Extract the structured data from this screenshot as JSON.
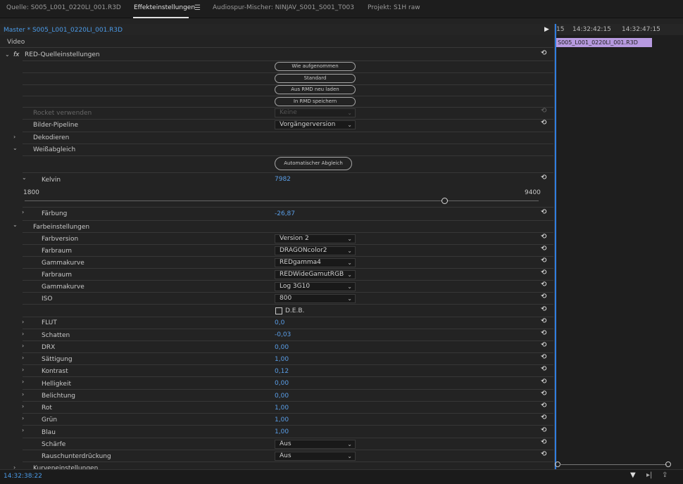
{
  "tabs": [
    {
      "label": "Quelle: S005_L001_0220LI_001.R3D"
    },
    {
      "label": "Effekteinstellungen"
    },
    {
      "label": "Audiospur-Mischer: NINJAV_S001_S001_T003"
    },
    {
      "label": "Projekt: S1H raw"
    }
  ],
  "header": {
    "master": "Master * S005_L001_0220LI_001.R3D",
    "video": "Video"
  },
  "fx": {
    "symbol": "fx",
    "title": "RED-Quelleinstellungen"
  },
  "buttons": {
    "as_shot": "Wie aufgenommen",
    "default": "Standard",
    "load_rmd": "Aus RMD neu laden",
    "save_rmd": "In RMD speichern",
    "auto_balance": "Automatischer Abgleich"
  },
  "rows": {
    "rocket": {
      "label": "Rocket verwenden",
      "value": "Keine"
    },
    "pipeline": {
      "label": "Bilder-Pipeline",
      "value": "Vorgängerversion"
    },
    "decode": {
      "label": "Dekodieren"
    },
    "wb": {
      "label": "Weißabgleich"
    },
    "kelvin": {
      "label": "Kelvin",
      "value": "7982"
    },
    "slider": {
      "min": "1800",
      "max": "9400",
      "value_fraction": 0.78
    },
    "tint": {
      "label": "Färbung",
      "value": "-26,87"
    },
    "color": {
      "label": "Farbeinstellungen"
    },
    "color_version": {
      "label": "Farbversion",
      "value": "Version 2"
    },
    "color_space": {
      "label": "Farbraum",
      "value": "DRAGONcolor2"
    },
    "gamma": {
      "label": "Gammakurve",
      "value": "REDgamma4"
    },
    "color_space2": {
      "label": "Farbraum",
      "value": "REDWideGamutRGB"
    },
    "gamma2": {
      "label": "Gammakurve",
      "value": "Log 3G10"
    },
    "iso": {
      "label": "ISO",
      "value": "800"
    },
    "deb": {
      "label": "D.E.B."
    },
    "flut": {
      "label": "FLUT",
      "value": "0,0"
    },
    "shadows": {
      "label": "Schatten",
      "value": "-0,03"
    },
    "drx": {
      "label": "DRX",
      "value": "0,00"
    },
    "saturation": {
      "label": "Sättigung",
      "value": "1,00"
    },
    "contrast": {
      "label": "Kontrast",
      "value": "0,12"
    },
    "brightness": {
      "label": "Helligkeit",
      "value": "0,00"
    },
    "exposure": {
      "label": "Belichtung",
      "value": "0,00"
    },
    "red": {
      "label": "Rot",
      "value": "1,00"
    },
    "green": {
      "label": "Grün",
      "value": "1,00"
    },
    "blue": {
      "label": "Blau",
      "value": "1,00"
    },
    "sharpness": {
      "label": "Schärfe",
      "value": "Aus"
    },
    "noise": {
      "label": "Rauschunterdrückung",
      "value": "Aus"
    },
    "curves": {
      "label": "Kurveneinstellungen"
    }
  },
  "timeline": {
    "tc1": "15",
    "tc2": "14:32:42:15",
    "tc3": "14:32:47:15",
    "clip": "S005_L001_0220LI_001.R3D"
  },
  "footer": {
    "timecode": "14:32:38:22"
  },
  "colors": {
    "accent": "#4b9be8",
    "clip": "#b79ae0"
  }
}
